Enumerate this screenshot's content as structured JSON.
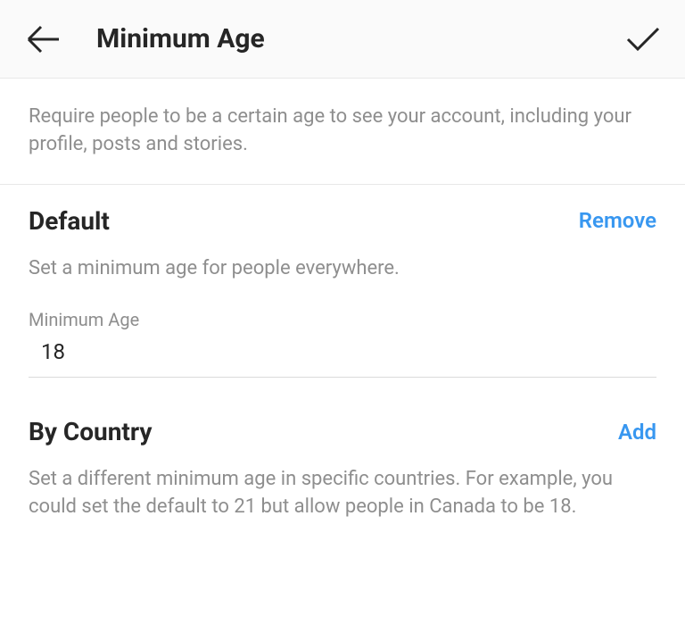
{
  "header": {
    "title": "Minimum Age"
  },
  "intro": {
    "text": "Require people to be a certain age to see your account, including your profile, posts and stories."
  },
  "default_section": {
    "title": "Default",
    "action": "Remove",
    "subtitle": "Set a minimum age for people everywhere.",
    "field_label": "Minimum Age",
    "field_value": "18"
  },
  "country_section": {
    "title": "By Country",
    "action": "Add",
    "subtitle": "Set a different minimum age in specific countries. For example, you could set the default to 21 but allow people in Canada to be 18."
  }
}
